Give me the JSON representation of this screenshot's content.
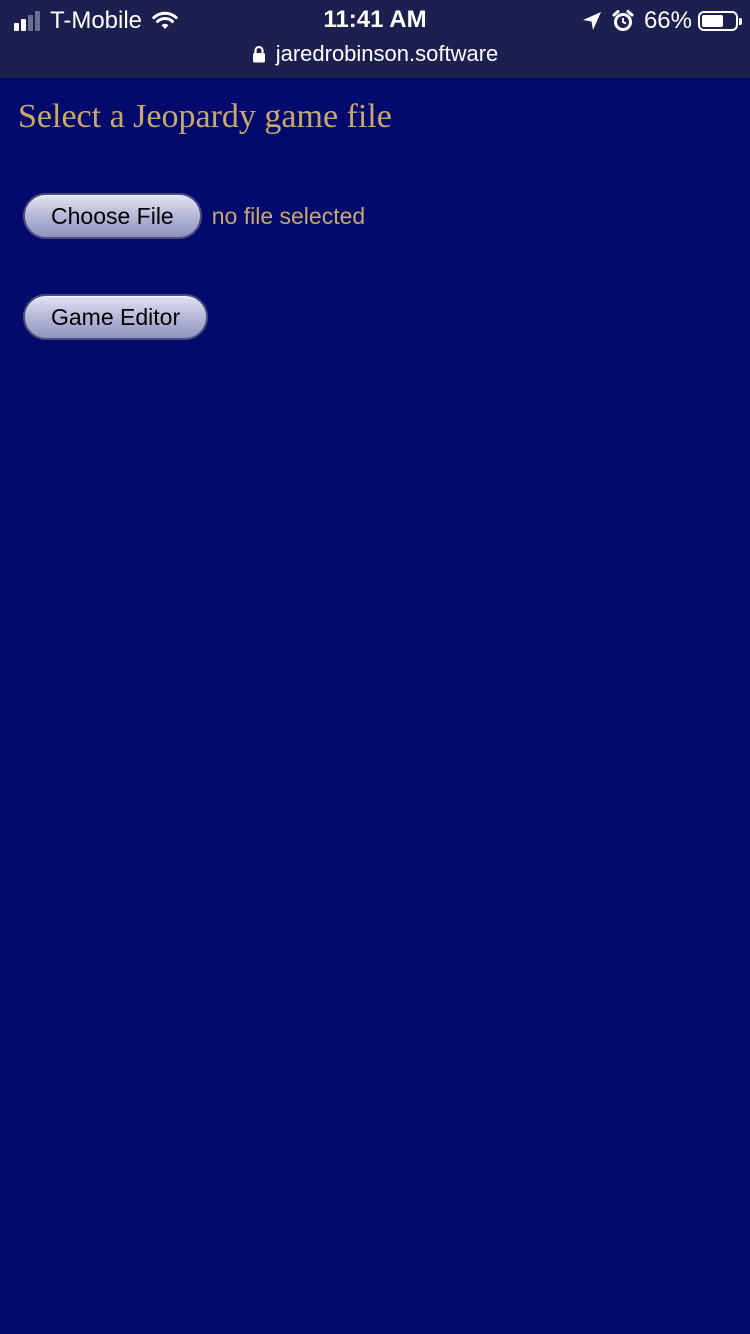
{
  "status_bar": {
    "carrier": "T-Mobile",
    "time": "11:41 AM",
    "battery": "66%",
    "battery_level": 0.66,
    "signal_bars": 2,
    "icons": [
      "signal-icon",
      "wifi-icon",
      "location-arrow-icon",
      "alarm-icon",
      "battery-icon"
    ]
  },
  "browser": {
    "url": "jaredrobinson.software",
    "lock_icon": "lock-icon"
  },
  "page": {
    "title": "Select a Jeopardy game file",
    "choose_file_label": "Choose File",
    "file_status": "no file selected",
    "game_editor_label": "Game Editor"
  },
  "colors": {
    "background": "#020a6e",
    "status_bar": "#1c1f4f",
    "accent_text": "#c9a86a"
  }
}
